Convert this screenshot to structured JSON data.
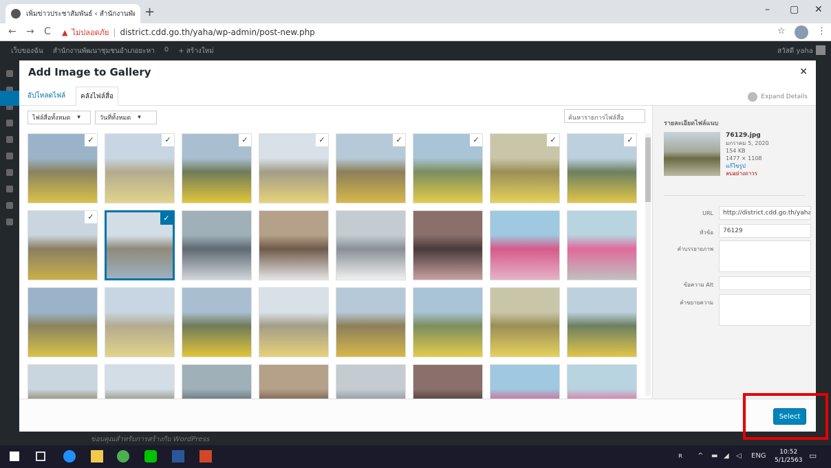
{
  "browser": {
    "tab_title": "เพิ่มข่าวประชาสัมพันธ์ ‹ สำนักงานพัฒ ×",
    "tab_close": "×",
    "new_tab": "+",
    "win_min": "–",
    "win_max": "▢",
    "win_close": "✕",
    "back": "←",
    "forward": "→",
    "reload": "C",
    "insecure_label": "ไม่ปลอดภัย",
    "url": "district.cdd.go.th/yaha/wp-admin/post-new.php",
    "star": "☆",
    "menu": "⋮"
  },
  "adminbar": {
    "items": [
      "เว็บของฉัน",
      "สำนักงานพัฒนาชุมชนอำเภอยะหา",
      "0",
      "+ สร้างใหม่"
    ],
    "user": "สวัสดี yaha"
  },
  "modal": {
    "title": "Add Image to Gallery",
    "close": "×",
    "tab_upload": "อัปโหลดไฟล์",
    "tab_library": "คลังไฟล์สื่อ",
    "expand_details": "Expand Details",
    "filter_type": "ไฟล์สื่อทั้งหมด",
    "filter_date": "วันที่ทั้งหมด",
    "search_placeholder": "ค้นหารายการไฟล์สื่อ",
    "select_button": "Select"
  },
  "details": {
    "heading": "รายละเอียดไฟล์แนบ",
    "filename": "76129.jpg",
    "date": "มกราคม 5, 2020",
    "size": "154 KB",
    "dimensions": "1477 × 1108",
    "edit_link": "แก้ไขรูป",
    "delete_link": "ลบอย่างถาวร",
    "fields": {
      "url_label": "URL",
      "url_value": "http://district.cdd.go.th/yaha/",
      "title_label": "หัวข้อ",
      "title_value": "76129",
      "caption_label": "คำบรรยายภาพ",
      "alt_label": "ข้อความ Alt",
      "desc_label": "คำขยายความ"
    }
  },
  "bottom_text": "ขอบคุณสำหรับการสร้างกับ WordPress",
  "taskbar": {
    "lang": "ENG",
    "time": "10:52",
    "date": "5/1/2563"
  },
  "colors": {
    "accent": "#0073aa",
    "button": "#0085ba",
    "highlight": "#e60000"
  }
}
